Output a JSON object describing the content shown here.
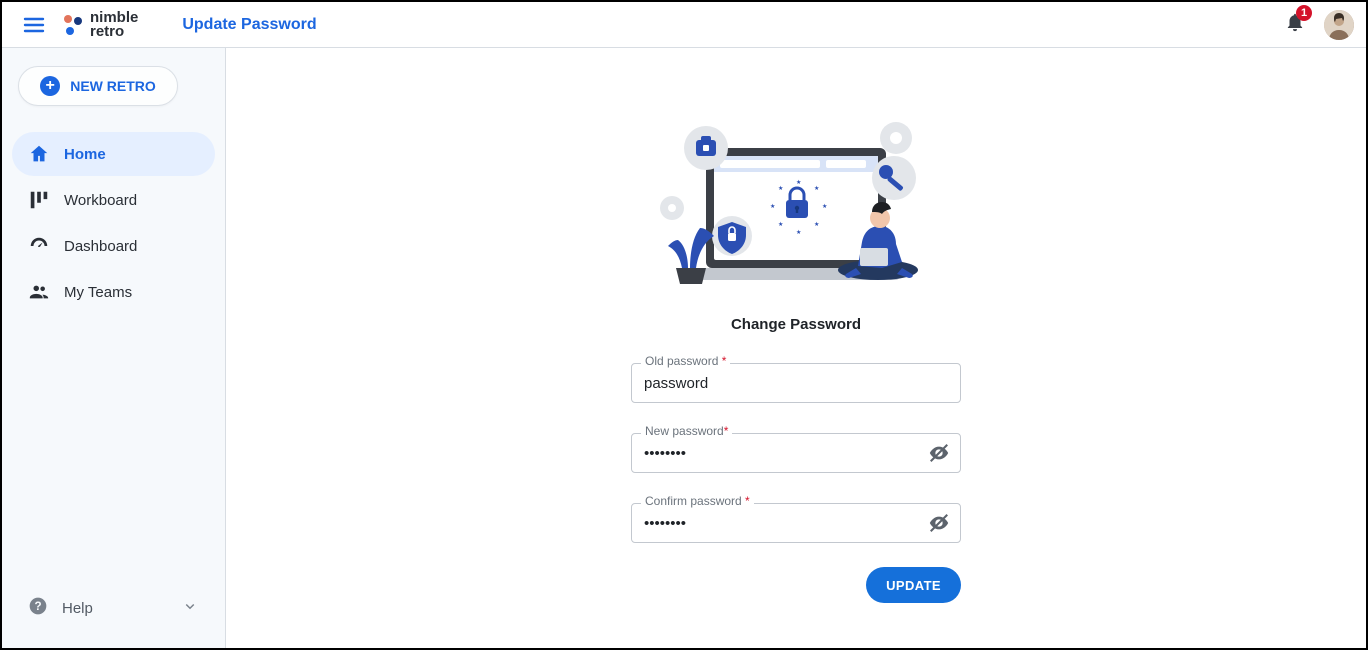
{
  "brand": {
    "name_line1": "nimble",
    "name_line2": "retro"
  },
  "header": {
    "page_title": "Update Password",
    "notification_count": "1"
  },
  "sidebar": {
    "new_retro_label": "NEW RETRO",
    "items": [
      {
        "label": "Home",
        "icon": "home-icon",
        "active": true
      },
      {
        "label": "Workboard",
        "icon": "workboard-icon",
        "active": false
      },
      {
        "label": "Dashboard",
        "icon": "dashboard-icon",
        "active": false
      },
      {
        "label": "My Teams",
        "icon": "teams-icon",
        "active": false
      }
    ],
    "help_label": "Help"
  },
  "main": {
    "card_title": "Change Password",
    "fields": {
      "old": {
        "label": "Old password",
        "value": "password",
        "type": "text"
      },
      "new": {
        "label": "New password",
        "value": "••••••••",
        "type": "password"
      },
      "confirm": {
        "label": "Confirm password",
        "value": "••••••••",
        "type": "password"
      }
    },
    "update_label": "UPDATE"
  }
}
